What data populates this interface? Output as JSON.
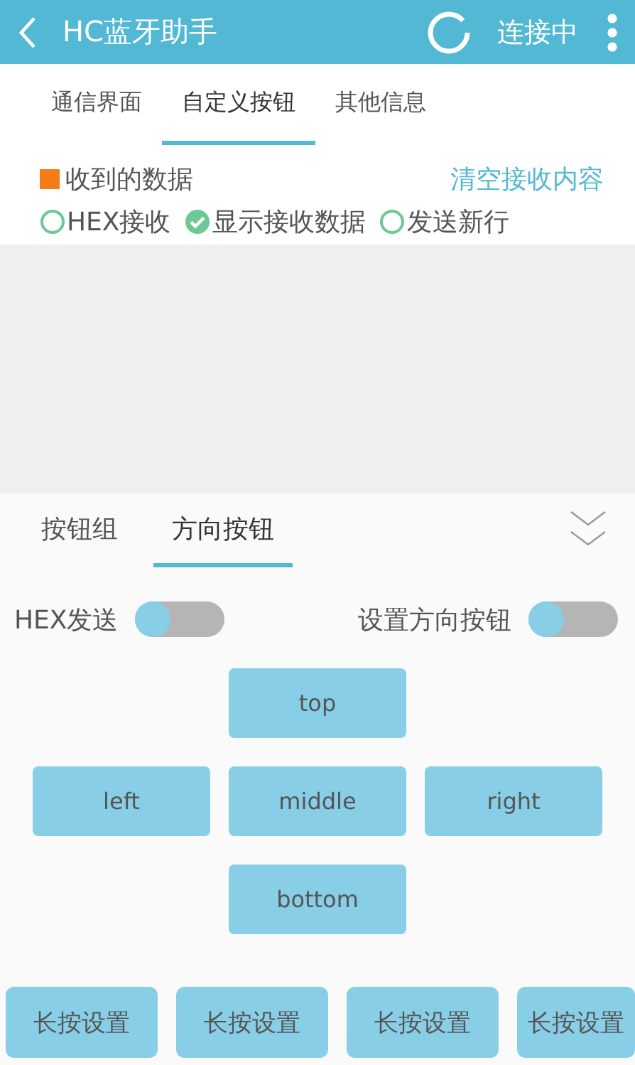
{
  "header": {
    "title": "HC蓝牙助手",
    "status": "连接中"
  },
  "tabs": [
    {
      "label": "通信界面",
      "selected": false
    },
    {
      "label": "自定义按钮",
      "selected": true
    },
    {
      "label": "其他信息",
      "selected": false
    }
  ],
  "received": {
    "label": "收到的数据",
    "clear": "清空接收内容"
  },
  "options": [
    {
      "label": "HEX接收",
      "checked": false
    },
    {
      "label": "显示接收数据",
      "checked": true
    },
    {
      "label": "发送新行",
      "checked": false
    }
  ],
  "panel_tabs": [
    {
      "label": "按钮组",
      "selected": false
    },
    {
      "label": "方向按钮",
      "selected": true
    }
  ],
  "toggles": [
    {
      "label": "HEX发送",
      "on": false
    },
    {
      "label": "设置方向按钮",
      "on": false
    }
  ],
  "direction_buttons": [
    "top",
    "left",
    "middle",
    "right",
    "bottom"
  ],
  "long_press_buttons": [
    "长按设置",
    "长按设置",
    "长按设置",
    "长按设置"
  ]
}
